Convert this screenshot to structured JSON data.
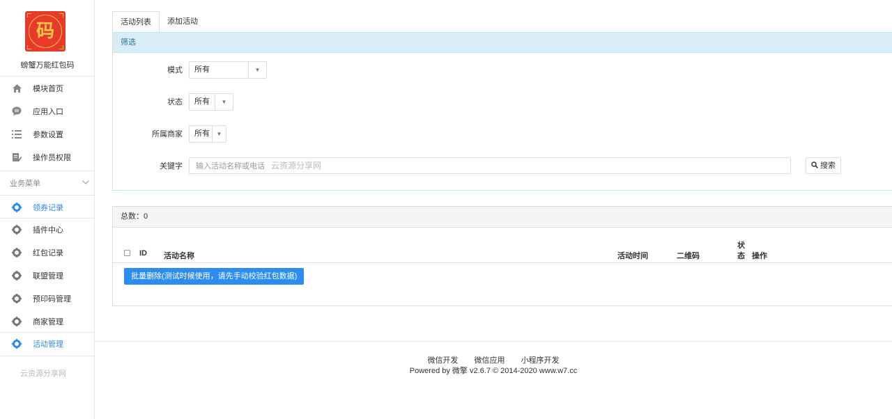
{
  "app": {
    "name": "螃蟹万能红包码",
    "logo_glyph": "码"
  },
  "sidebar": {
    "main_items": [
      {
        "label": "模块首页",
        "icon": "home-icon"
      },
      {
        "label": "应用入口",
        "icon": "chat-bubble-icon"
      },
      {
        "label": "参数设置",
        "icon": "list-icon"
      },
      {
        "label": "操作员权限",
        "icon": "edit-doc-icon"
      }
    ],
    "group_title": "业务菜单",
    "business_items": [
      {
        "label": "领券记录",
        "icon": "gear-icon",
        "active": true
      },
      {
        "label": "插件中心",
        "icon": "gear-icon"
      },
      {
        "label": "红包记录",
        "icon": "gear-icon"
      },
      {
        "label": "联盟管理",
        "icon": "gear-icon"
      },
      {
        "label": "预印码管理",
        "icon": "gear-icon"
      },
      {
        "label": "商家管理",
        "icon": "gear-icon"
      },
      {
        "label": "活动管理",
        "icon": "gear-icon",
        "active": true
      }
    ],
    "watermark": "云资源分享网"
  },
  "tabs": [
    {
      "label": "活动列表",
      "active": true
    },
    {
      "label": "添加活动",
      "active": false
    }
  ],
  "filter": {
    "title": "筛选",
    "mode_label": "模式",
    "mode_value": "所有",
    "status_label": "状态",
    "status_value": "所有",
    "merchant_label": "所属商家",
    "merchant_value": "所有",
    "keyword_label": "关键字",
    "keyword_placeholder": "输入活动名称或电话",
    "keyword_watermark": "云资源分享网",
    "search_label": "搜索"
  },
  "list": {
    "total_label": "总数：0",
    "columns": {
      "id": "ID",
      "name": "活动名称",
      "time": "活动时间",
      "qrcode": "二维码",
      "status_1": "状",
      "status_2": "态",
      "actions": "操作"
    },
    "bulk_delete_label": "批量删除(测试时候使用，请先手动校验红包数据)"
  },
  "footer": {
    "links": [
      "微信开发",
      "微信应用",
      "小程序开发"
    ],
    "copyright": "Powered by 微擎 v2.6.7 © 2014-2020 www.w7.cc"
  },
  "colors": {
    "accent": "#2d8cf0",
    "filter_header": "#d9edf7",
    "logo_bg": "#e83a2a"
  }
}
